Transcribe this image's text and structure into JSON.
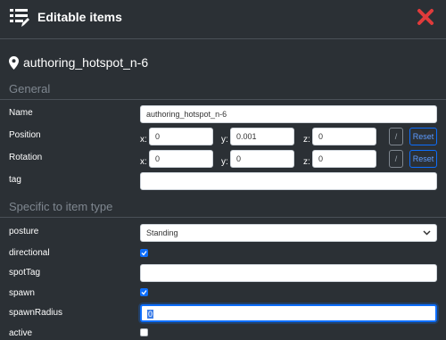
{
  "header": {
    "title": "Editable items",
    "app_icon": "list-edit-icon",
    "close_icon": "close-x-icon",
    "close_color": "#e03b3b"
  },
  "item": {
    "icon": "map-pin-icon",
    "name": "authoring_hotspot_n-6"
  },
  "sections": {
    "general": "General",
    "specific": "Specific to item type"
  },
  "fields": {
    "name": {
      "label": "Name",
      "value": "authoring_hotspot_n-6"
    },
    "position": {
      "label": "Position",
      "x_label": "x:",
      "x": "0",
      "y_label": "y:",
      "y": "0.001",
      "z_label": "z:",
      "z": "0",
      "pick_label": "/",
      "reset_label": "Reset"
    },
    "rotation": {
      "label": "Rotation",
      "x_label": "x:",
      "x": "0",
      "y_label": "y:",
      "y": "0",
      "z_label": "z:",
      "z": "0",
      "pick_label": "/",
      "reset_label": "Reset"
    },
    "tag": {
      "label": "tag",
      "value": ""
    },
    "posture": {
      "label": "posture",
      "value": "Standing"
    },
    "directional": {
      "label": "directional",
      "checked": true
    },
    "spotTag": {
      "label": "spotTag",
      "value": ""
    },
    "spawn": {
      "label": "spawn",
      "checked": true
    },
    "spawnRadius": {
      "label": "spawnRadius",
      "value": "0"
    },
    "active": {
      "label": "active",
      "checked": false
    }
  },
  "colors": {
    "background": "#2b3035",
    "accent": "#0d6efd",
    "section_text": "#7f8790"
  }
}
